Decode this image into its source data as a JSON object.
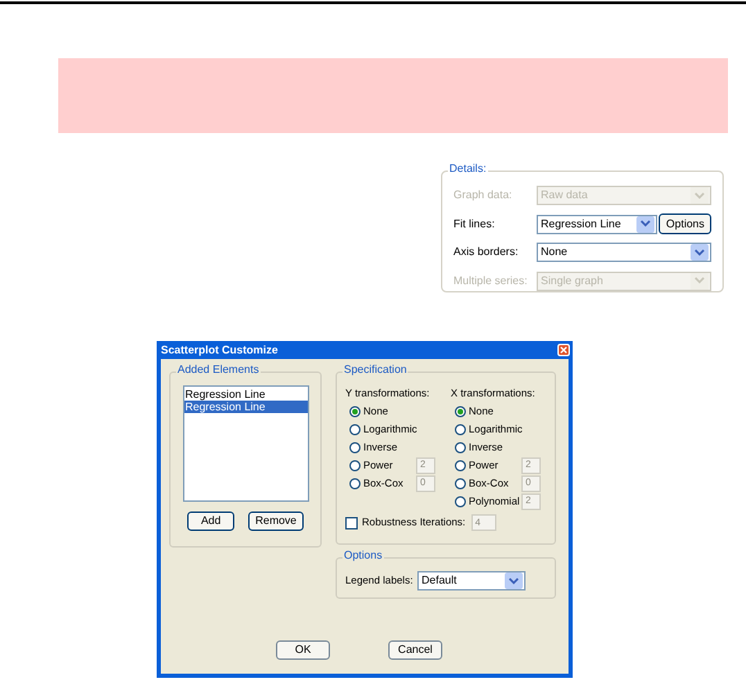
{
  "details": {
    "title": "Details:",
    "rows": [
      {
        "label": "Graph data:",
        "value": "Raw data",
        "disabled": true
      },
      {
        "label": "Fit lines:",
        "value": "Regression Line",
        "disabled": false,
        "button": "Options"
      },
      {
        "label": "Axis borders:",
        "value": "None",
        "disabled": false
      },
      {
        "label": "Multiple series:",
        "value": "Single graph",
        "disabled": true
      }
    ]
  },
  "dialog": {
    "title": "Scatterplot Customize",
    "added_elements": {
      "title": "Added Elements",
      "items": [
        {
          "label": "Regression Line",
          "selected": false
        },
        {
          "label": "Regression Line",
          "selected": true
        }
      ],
      "buttons": [
        "Add",
        "Remove"
      ]
    },
    "specification": {
      "title": "Specification",
      "columns": [
        {
          "heading": "Y transformations:",
          "options": [
            {
              "label": "None",
              "selected": true
            },
            {
              "label": "Logarithmic",
              "selected": false
            },
            {
              "label": "Inverse",
              "selected": false
            },
            {
              "label": "Power",
              "selected": false,
              "value": "2"
            },
            {
              "label": "Box-Cox",
              "selected": false,
              "value": "0"
            }
          ]
        },
        {
          "heading": "X transformations:",
          "options": [
            {
              "label": "None",
              "selected": true
            },
            {
              "label": "Logarithmic",
              "selected": false
            },
            {
              "label": "Inverse",
              "selected": false
            },
            {
              "label": "Power",
              "selected": false,
              "value": "2"
            },
            {
              "label": "Box-Cox",
              "selected": false,
              "value": "0"
            },
            {
              "label": "Polynomial",
              "selected": false,
              "value": "2"
            }
          ]
        }
      ],
      "robustness": {
        "label": "Robustness Iterations:",
        "checked": false,
        "value": "4"
      }
    },
    "options": {
      "title": "Options",
      "legend_label": "Legend labels:",
      "legend_value": "Default"
    },
    "buttons": [
      "OK",
      "Cancel"
    ]
  }
}
